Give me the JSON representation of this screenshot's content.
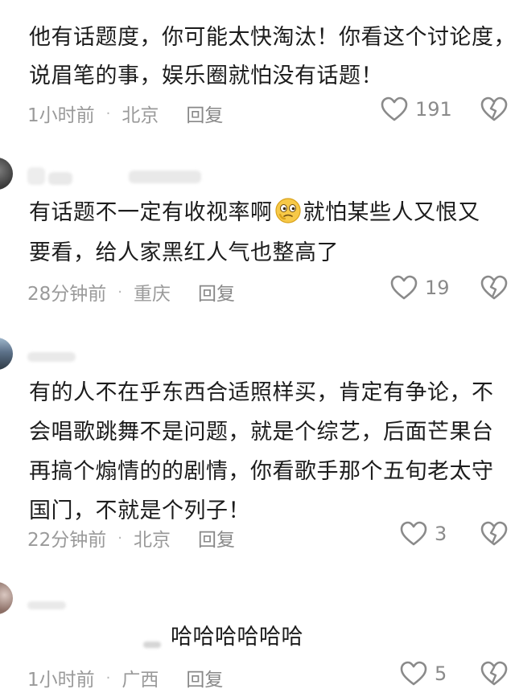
{
  "comments": [
    {
      "lines": [
        "他有话题度，你可能太快淘汰！你看这个讨论度，",
        "说眉笔的事，娱乐圈就怕没有话题！"
      ],
      "time": "1小时前",
      "dot": "·",
      "location": "北京",
      "reply": "回复",
      "likes": "191"
    },
    {
      "lines_before_emoji": "有话题不一定有收视率啊",
      "lines_after_emoji": "就怕某些人又恨又",
      "line2": "要看，给人家黑红人气也整高了",
      "time": "28分钟前",
      "dot": "·",
      "location": "重庆",
      "reply": "回复",
      "likes": "19"
    },
    {
      "lines": [
        "有的人不在乎东西合适照样买，肯定有争论，不",
        "会唱歌跳舞不是问题，就是个综艺，后面芒果台",
        "再搞个煽情的的剧情，你看歌手那个五旬老太守",
        "国门，不就是个列子！"
      ],
      "time": "22分钟前",
      "dot": "·",
      "location": "北京",
      "reply": "回复",
      "likes": "3"
    },
    {
      "lines": [
        "哈哈哈哈哈哈"
      ],
      "time": "1小时前",
      "dot": "·",
      "location": "广西",
      "reply": "回复",
      "likes": "5"
    }
  ],
  "icons": {
    "like": "heart-outline-icon",
    "dislike": "broken-heart-icon",
    "emoji": "thinking-face-emoji"
  },
  "colors": {
    "text": "#1c1c1c",
    "meta": "#9a9a9a",
    "icon": "#8a8a8a"
  }
}
